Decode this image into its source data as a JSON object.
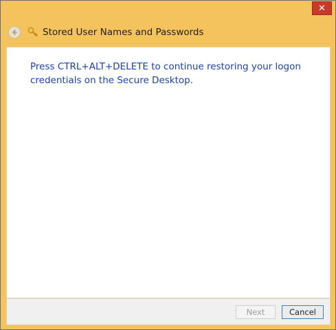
{
  "window": {
    "title": "Stored User Names and Passwords",
    "close_glyph": "✕",
    "frame_color": "#f5c35d",
    "close_color": "#c7392b"
  },
  "icons": {
    "back": "back-arrow-icon",
    "title": "key-icon"
  },
  "content": {
    "instruction": "Press CTRL+ALT+DELETE to continue restoring your logon credentials on the Secure Desktop.",
    "text_color": "#1a3fa8"
  },
  "footer": {
    "next_label": "Next",
    "next_enabled": false,
    "cancel_label": "Cancel"
  }
}
